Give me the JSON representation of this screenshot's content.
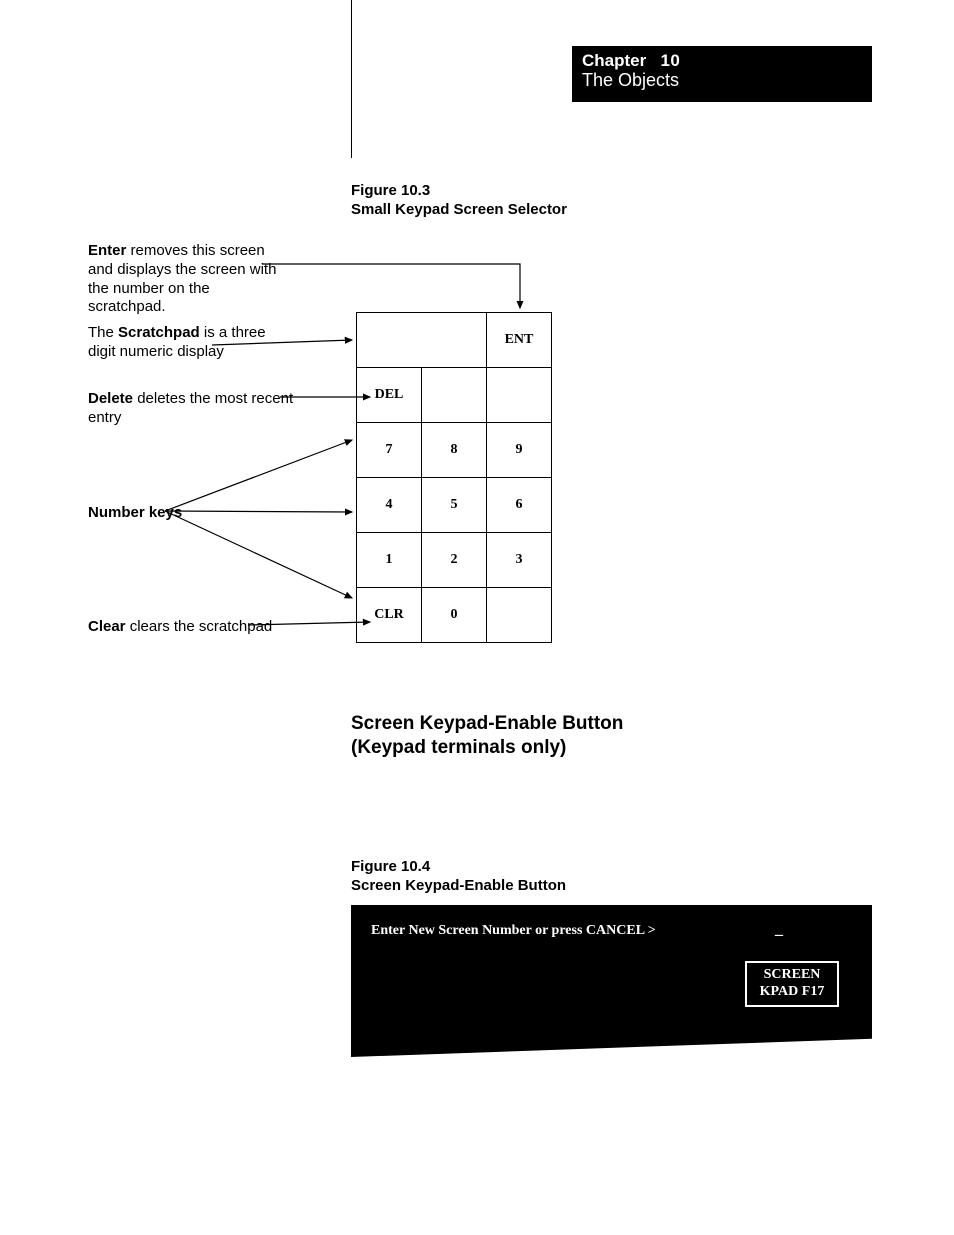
{
  "banner": {
    "chapter_label": "Chapter",
    "chapter_number": "10",
    "subtitle": "The Objects"
  },
  "figure_103": {
    "number": "Figure 10.3",
    "title": "Small Keypad Screen Selector"
  },
  "annotations": {
    "enter": {
      "bold": "Enter",
      "rest": " removes this screen and displays the screen with the number on the scratchpad."
    },
    "scratchpad": {
      "pre": "The ",
      "bold": "Scratchpad",
      "rest": " is a three digit numeric display"
    },
    "delete": {
      "bold": "Delete",
      "rest": " deletes the most recent entry"
    },
    "number_keys": {
      "bold": "Number keys"
    },
    "clear": {
      "bold": "Clear",
      "rest": " clears the scratchpad"
    }
  },
  "keypad": {
    "ent": "ENT",
    "del": "DEL",
    "clr": "CLR",
    "k7": "7",
    "k8": "8",
    "k9": "9",
    "k4": "4",
    "k5": "5",
    "k6": "6",
    "k1": "1",
    "k2": "2",
    "k3": "3",
    "k0": "0"
  },
  "section_heading": {
    "l1": "Screen Keypad-Enable Button",
    "l2": "(Keypad terminals only)"
  },
  "figure_104": {
    "number": "Figure 10.4",
    "title": "Screen Keypad-Enable Button"
  },
  "panel": {
    "prompt": "Enter New Screen Number or press CANCEL >",
    "cursor": "_",
    "button_l1": "SCREEN",
    "button_l2": "KPAD F17"
  }
}
